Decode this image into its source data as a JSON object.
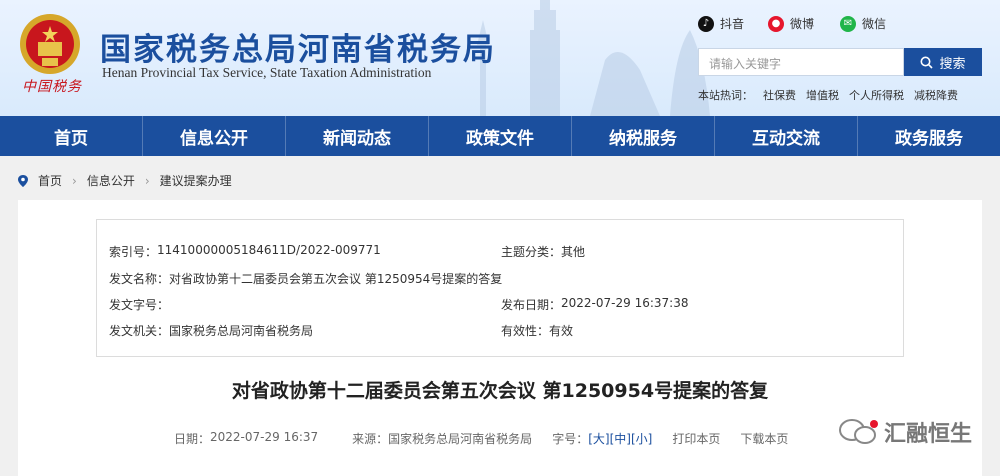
{
  "header": {
    "title": "国家税务总局河南省税务局",
    "subtitle": "Henan Provincial Tax Service, State Taxation Administration",
    "tax_mark": "中国税务",
    "social": [
      {
        "icon": "douyin-icon",
        "label": "抖音"
      },
      {
        "icon": "weibo-icon",
        "label": "微博"
      },
      {
        "icon": "wechat-icon",
        "label": "微信"
      }
    ],
    "search": {
      "placeholder": "请输入关键字",
      "button": "搜索"
    },
    "hot_label": "本站热词：",
    "hot_words": [
      "社保费",
      "增值税",
      "个人所得税",
      "减税降费"
    ]
  },
  "nav": [
    "首页",
    "信息公开",
    "新闻动态",
    "政策文件",
    "纳税服务",
    "互动交流",
    "政务服务"
  ],
  "breadcrumb": [
    "首页",
    "信息公开",
    "建议提案办理"
  ],
  "meta": {
    "index_label": "索引号：",
    "index_value": "11410000005184611D/2022-009771",
    "topic_label": "主题分类：",
    "topic_value": "其他",
    "name_label": "发文名称：",
    "name_value": "对省政协第十二届委员会第五次会议 第1250954号提案的答复",
    "doc_no_label": "发文字号：",
    "doc_no_value": "",
    "date_label": "发布日期：",
    "date_value": "2022-07-29 16:37:38",
    "org_label": "发文机关：",
    "org_value": "国家税务总局河南省税务局",
    "valid_label": "有效性：",
    "valid_value": "有效"
  },
  "article": {
    "title": "对省政协第十二届委员会第五次会议 第1250954号提案的答复",
    "date_label": "日期：",
    "date_value": "2022-07-29 16:37",
    "source_label": "来源：",
    "source_value": "国家税务总局河南省税务局",
    "size_label": "字号：",
    "size_large": "[大]",
    "size_medium": "[中]",
    "size_small": "[小]",
    "print": "打印本页",
    "download": "下载本页"
  },
  "watermark": "汇融恒生"
}
